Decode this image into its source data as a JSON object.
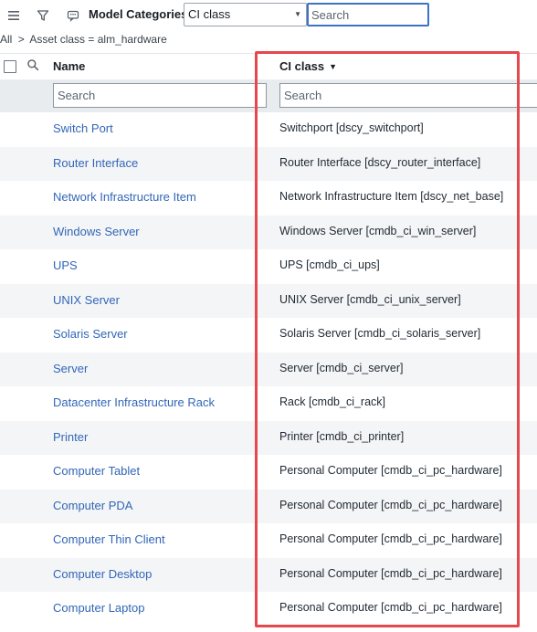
{
  "toolbar": {
    "title": "Model Categories",
    "field_select": "CI class",
    "search_placeholder": "Search"
  },
  "breadcrumb": {
    "root": "All",
    "separator": ">",
    "filter": "Asset class = alm_hardware"
  },
  "columns": {
    "name": "Name",
    "ci_class": "CI class"
  },
  "filters": {
    "name_placeholder": "Search",
    "ci_class_placeholder": "Search"
  },
  "rows": [
    {
      "name": "Switch Port",
      "ci_class": "Switchport [dscy_switchport]"
    },
    {
      "name": "Router Interface",
      "ci_class": "Router Interface [dscy_router_interface]"
    },
    {
      "name": "Network Infrastructure Item",
      "ci_class": "Network Infrastructure Item [dscy_net_base]"
    },
    {
      "name": "Windows Server",
      "ci_class": "Windows Server [cmdb_ci_win_server]"
    },
    {
      "name": "UPS",
      "ci_class": "UPS [cmdb_ci_ups]"
    },
    {
      "name": "UNIX Server",
      "ci_class": "UNIX Server [cmdb_ci_unix_server]"
    },
    {
      "name": "Solaris Server",
      "ci_class": "Solaris Server [cmdb_ci_solaris_server]"
    },
    {
      "name": "Server",
      "ci_class": "Server [cmdb_ci_server]"
    },
    {
      "name": "Datacenter Infrastructure Rack",
      "ci_class": "Rack [cmdb_ci_rack]"
    },
    {
      "name": "Printer",
      "ci_class": "Printer [cmdb_ci_printer]"
    },
    {
      "name": "Computer Tablet",
      "ci_class": "Personal Computer [cmdb_ci_pc_hardware]"
    },
    {
      "name": "Computer PDA",
      "ci_class": "Personal Computer [cmdb_ci_pc_hardware]"
    },
    {
      "name": "Computer Thin Client",
      "ci_class": "Personal Computer [cmdb_ci_pc_hardware]"
    },
    {
      "name": "Computer Desktop",
      "ci_class": "Personal Computer [cmdb_ci_pc_hardware]"
    },
    {
      "name": "Computer Laptop",
      "ci_class": "Personal Computer [cmdb_ci_pc_hardware]"
    }
  ],
  "colors": {
    "link": "#3266b8",
    "highlight_border": "#e5484d",
    "search_focus": "#3b73c6"
  }
}
